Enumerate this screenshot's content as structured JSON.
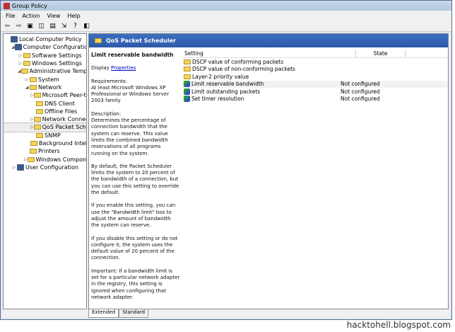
{
  "window": {
    "title": "Group Policy"
  },
  "menu": [
    "File",
    "Action",
    "View",
    "Help"
  ],
  "toolbar": [
    {
      "icon": "back-icon",
      "g": "⇦"
    },
    {
      "icon": "forward-icon",
      "g": "⇨"
    },
    {
      "icon": "up-folder-icon",
      "g": "▣"
    },
    {
      "icon": "show-hide-tree-icon",
      "g": "◫"
    },
    {
      "icon": "properties-icon",
      "g": "▤"
    },
    {
      "icon": "export-list-icon",
      "g": "⇲"
    },
    {
      "icon": "help-icon",
      "g": "?"
    },
    {
      "icon": "extended-view-icon",
      "g": "◧"
    }
  ],
  "tree": [
    {
      "label": "Local Computer Policy",
      "level": 0,
      "type": "root",
      "exp": ""
    },
    {
      "label": "Computer Configuration",
      "level": 1,
      "type": "pc",
      "exp": "◢"
    },
    {
      "label": "Software Settings",
      "level": 2,
      "type": "folder",
      "exp": "▷"
    },
    {
      "label": "Windows Settings",
      "level": 2,
      "type": "folder",
      "exp": "▷"
    },
    {
      "label": "Administrative Templates",
      "level": 2,
      "type": "folder",
      "exp": "◢"
    },
    {
      "label": "System",
      "level": 3,
      "type": "folder",
      "exp": "▷"
    },
    {
      "label": "Network",
      "level": 3,
      "type": "folder",
      "exp": "◢"
    },
    {
      "label": "Microsoft Peer-to-Peer Networking Services",
      "level": 4,
      "type": "folder",
      "exp": "▷"
    },
    {
      "label": "DNS Client",
      "level": 4,
      "type": "folder",
      "exp": ""
    },
    {
      "label": "Offline Files",
      "level": 4,
      "type": "folder",
      "exp": ""
    },
    {
      "label": "Network Connections",
      "level": 4,
      "type": "folder",
      "exp": "▷"
    },
    {
      "label": "QoS Packet Scheduler",
      "level": 4,
      "type": "folder",
      "exp": "▷",
      "selected": true
    },
    {
      "label": "SNMP",
      "level": 4,
      "type": "folder",
      "exp": ""
    },
    {
      "label": "Background Intelligent Transfer Service",
      "level": 4,
      "type": "folder",
      "exp": ""
    },
    {
      "label": "Printers",
      "level": 3,
      "type": "folder",
      "exp": ""
    },
    {
      "label": "Windows Components",
      "level": 3,
      "type": "folder",
      "exp": "▷"
    },
    {
      "label": "User Configuration",
      "level": 1,
      "type": "pc",
      "exp": "▷"
    }
  ],
  "header": {
    "title": "QoS Packet Scheduler"
  },
  "description": {
    "title": "Limit reservable bandwidth",
    "display_label": "Display",
    "properties_link": "Properties",
    "paragraphs": [
      "Requirements:\nAt least Microsoft Windows XP Professional or Windows Server 2003 family",
      "Description:\nDetermines the percentage of connection bandwidth that the system can reserve. This value limits the combined bandwidth reservations of all programs running on the system.",
      "By default, the Packet Scheduler limits the system to 20 percent of the bandwidth of a connection, but you can use this setting to override the default.",
      "If you enable this setting, you can use the \"Bandwidth limit\" box to adjust the amount of bandwidth the system can reserve.",
      "If you disable this setting or do not configure it, the system uses the default value of 20 percent of the connection.",
      "Important: If a bandwidth limit is set for a particular network adapter in the registry, this setting is ignored when configuring that network adapter."
    ]
  },
  "list": {
    "columns": [
      "Setting",
      "State"
    ],
    "rows": [
      {
        "setting": "DSCP value of conforming packets",
        "state": "",
        "type": "folder"
      },
      {
        "setting": "DSCP value of non-conforming packets",
        "state": "",
        "type": "folder"
      },
      {
        "setting": "Layer-2 priority value",
        "state": "",
        "type": "folder"
      },
      {
        "setting": "Limit reservable bandwidth",
        "state": "Not configured",
        "type": "policy",
        "hl": true
      },
      {
        "setting": "Limit outstanding packets",
        "state": "Not configured",
        "type": "policy"
      },
      {
        "setting": "Set timer resolution",
        "state": "Not configured",
        "type": "policy"
      }
    ]
  },
  "tabs": [
    "Extended",
    "Standard"
  ],
  "watermark": "hacktohell.blogspot.com"
}
